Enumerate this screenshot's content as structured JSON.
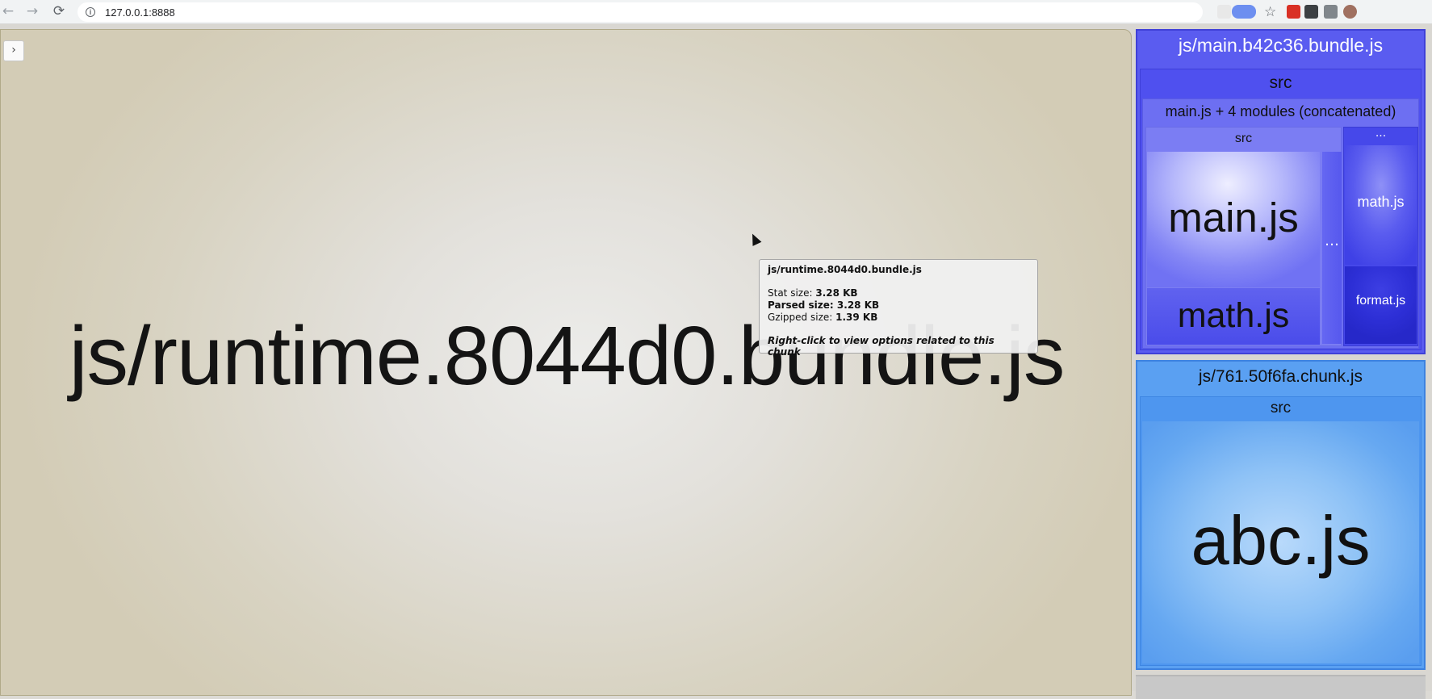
{
  "browser": {
    "url": "127.0.0.1:8888",
    "back_icon": "←",
    "forward_icon": "→",
    "reload_icon": "⟳",
    "star_icon": "☆"
  },
  "sidebar_toggle": {
    "icon": "›"
  },
  "treemap": {
    "runtime_bundle": "js/runtime.8044d0.bundle.js",
    "main_bundle": {
      "title": "js/main.b42c36.bundle.js",
      "src_label": "src",
      "concat_label": "main.js + 4 modules (concatenated)",
      "concat_src_label": "src",
      "main_js": "main.js",
      "math_js": "math.js",
      "more_label": "…",
      "dots_label": "···",
      "math_js_b": "math.js",
      "format_js": "format.js"
    },
    "chunk_761": {
      "title": "js/761.50f6fa.chunk.js",
      "src_label": "src",
      "abc_js": "abc.js"
    }
  },
  "tooltip": {
    "title": "js/runtime.8044d0.bundle.js",
    "stat_label": "Stat size:",
    "stat_value": "3.28 KB",
    "parsed_label": "Parsed size:",
    "parsed_value": "3.28 KB",
    "gzipped_label": "Gzipped size:",
    "gzipped_value": "1.39 KB",
    "hint": "Right-click to view options related to this chunk"
  },
  "colors": {
    "main_bundle": "#5a5cf0",
    "chunk_761": "#5aa0f2",
    "runtime_bundle": "#d8d3c2"
  }
}
